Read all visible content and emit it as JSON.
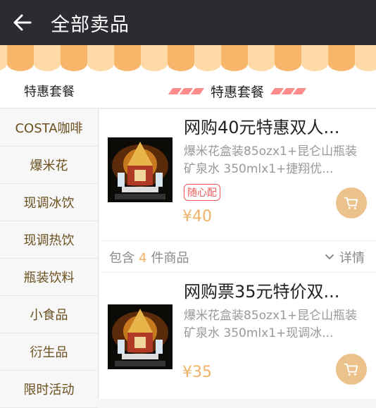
{
  "header": {
    "title": "全部卖品",
    "back_icon": "arrow-left-icon"
  },
  "category_header": {
    "left_label": "特惠套餐",
    "center_label": "特惠套餐"
  },
  "sidebar": {
    "items": [
      {
        "label": "COSTA咖啡"
      },
      {
        "label": "爆米花"
      },
      {
        "label": "现调冰饮"
      },
      {
        "label": "现调热饮"
      },
      {
        "label": "瓶装饮料"
      },
      {
        "label": "小食品"
      },
      {
        "label": "衍生品"
      },
      {
        "label": "限时活动"
      }
    ]
  },
  "products": [
    {
      "title": "网购40元特惠双人...",
      "description": "爆米花盒装85ozx1+昆仑山瓶装矿泉水 350mlx1+捷翔优...",
      "tag": "随心配",
      "price": "¥40",
      "contains_prefix": "包含",
      "contains_count": "4",
      "contains_suffix": "件商品",
      "details_label": "详情"
    },
    {
      "title": "网购票35元特价双...",
      "description": "爆米花盒装85ozx1+昆仑山瓶装矿泉水 350mlx1+现调冰...",
      "price": "¥35"
    }
  ],
  "colors": {
    "header_bg": "#2b2c31",
    "price": "#f0b267",
    "cart_button": "#ebc28c",
    "tag": "#ee5a5a",
    "sidebar_text": "#6b4f1e"
  }
}
